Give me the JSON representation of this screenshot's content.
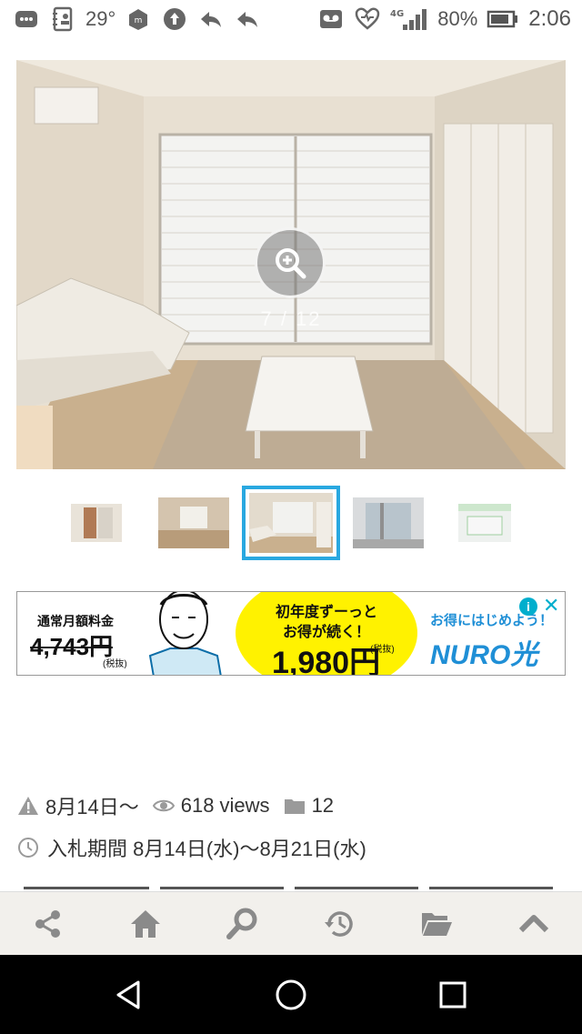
{
  "status_bar": {
    "temperature": "29°",
    "network": "4G",
    "battery": "80%",
    "time": "2:06"
  },
  "gallery": {
    "counter": "7 / 12",
    "thumbnail_count": 5,
    "active_index": 3
  },
  "ad": {
    "old_label": "通常月額料金",
    "old_price": "4,743円",
    "old_tax": "(税抜)",
    "promo_line1": "初年度ずーっと",
    "promo_line2": "お得が続く！",
    "promo_price": "1,980円",
    "promo_tax": "(税抜)",
    "right_text": "お得にはじめよう！",
    "brand": "NURO光",
    "info_icon": "i",
    "close_icon": "✕"
  },
  "meta": {
    "date": "8月14日〜",
    "views": "618 views",
    "count": "12"
  },
  "period": {
    "text": "入札期間 8月14日(水)〜8月21日(水)"
  },
  "colors": {
    "accent": "#29a8e0",
    "toolbar_bg": "#f2f0ec",
    "icon_gray": "#8a8a8a"
  }
}
